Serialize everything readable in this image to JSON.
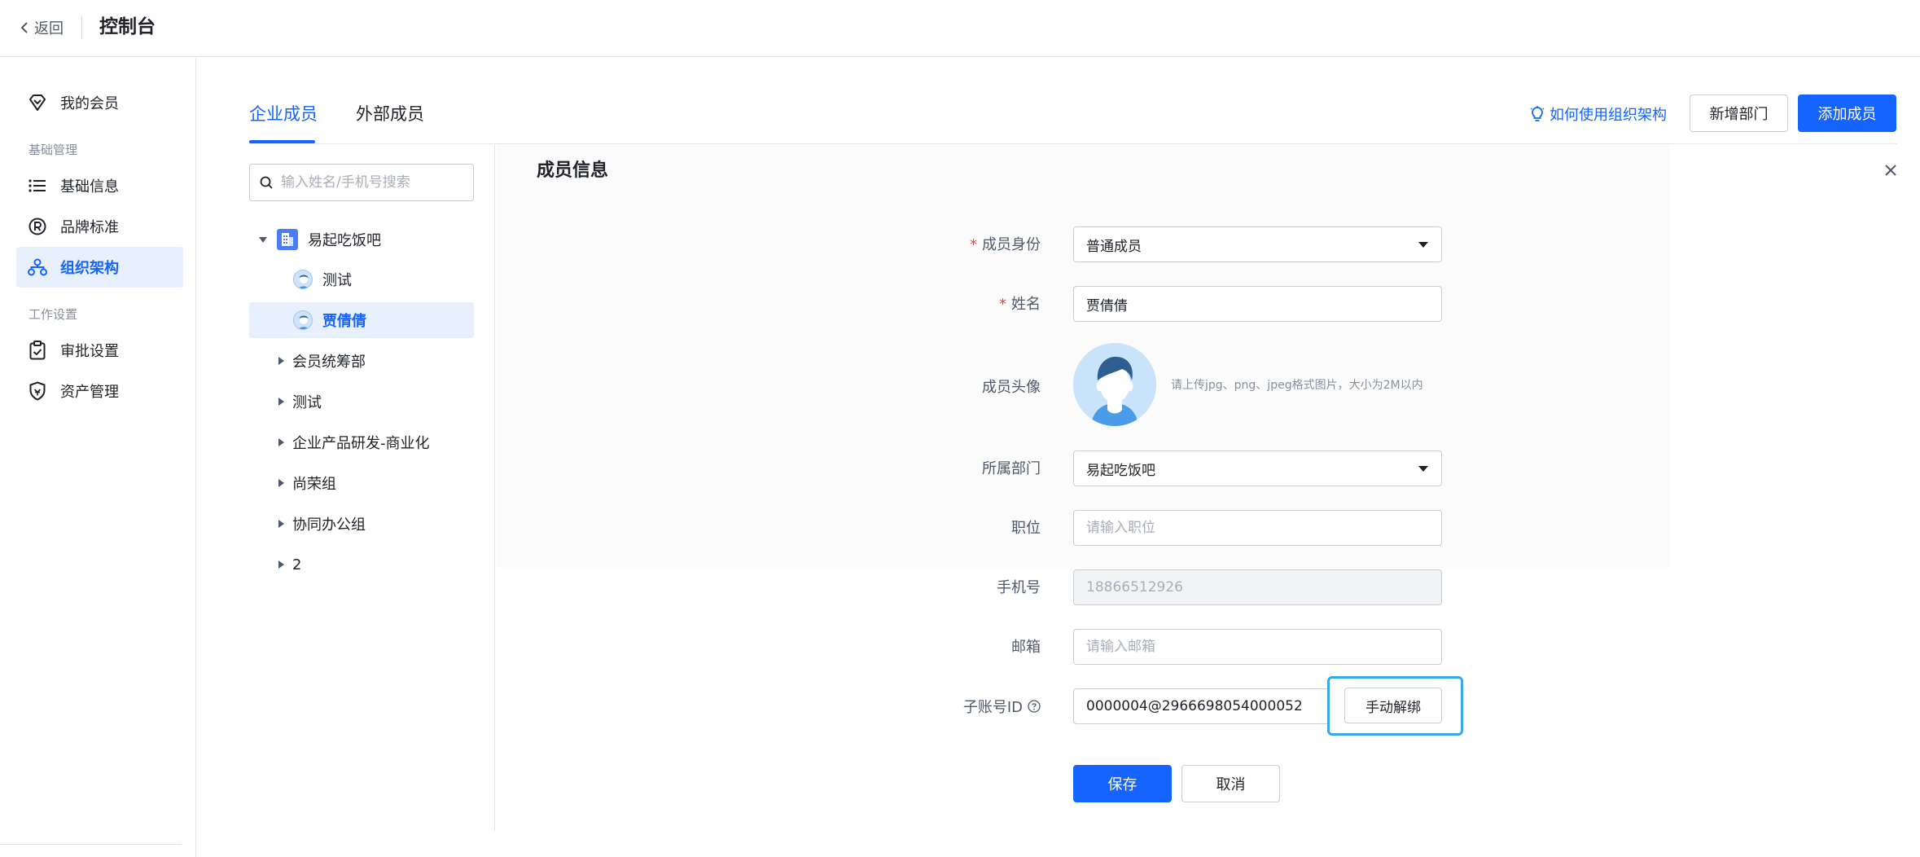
{
  "topbar": {
    "back_label": "返回",
    "title": "控制台"
  },
  "sidebar": {
    "my_membership": "我的会员",
    "group_basic": "基础管理",
    "basic_info": "基础信息",
    "brand_standard": "品牌标准",
    "org_structure": "组织架构",
    "group_work": "工作设置",
    "approval_settings": "审批设置",
    "asset_management": "资产管理"
  },
  "tabs": {
    "internal": "企业成员",
    "external": "外部成员"
  },
  "header_actions": {
    "help_link": "如何使用组织架构",
    "add_department": "新增部门",
    "add_member": "添加成员"
  },
  "tree": {
    "search_placeholder": "输入姓名/手机号搜索",
    "root": "易起吃饭吧",
    "members": [
      "测试",
      "贾倩倩"
    ],
    "departments": [
      "会员统筹部",
      "测试",
      "企业产品研发-商业化",
      "尚荣组",
      "协同办公组",
      "2"
    ]
  },
  "form": {
    "title": "成员信息",
    "identity_label": "成员身份",
    "identity_value": "普通成员",
    "name_label": "姓名",
    "name_value": "贾倩倩",
    "avatar_label": "成员头像",
    "avatar_hint": "请上传jpg、png、jpeg格式图片，大小为2M以内",
    "department_label": "所属部门",
    "department_value": "易起吃饭吧",
    "position_label": "职位",
    "position_placeholder": "请输入职位",
    "phone_label": "手机号",
    "phone_value": "18866512926",
    "email_label": "邮箱",
    "email_placeholder": "请输入邮箱",
    "subaccount_label": "子账号ID",
    "subaccount_value": "0000004@2966698054000052",
    "unbind_button": "手动解绑",
    "save_button": "保存",
    "cancel_button": "取消"
  },
  "colors": {
    "primary": "#1664ff",
    "required": "#f53f3f",
    "highlight": "#3aa7e6"
  },
  "icons": [
    "chevron-left-icon",
    "diamond-icon",
    "list-icon",
    "registered-icon",
    "org-structure-icon",
    "clipboard-check-icon",
    "shield-icon",
    "lightbulb-icon",
    "search-icon",
    "building-icon",
    "avatar-icon",
    "close-icon",
    "help-circle-icon",
    "caret-down-icon"
  ]
}
